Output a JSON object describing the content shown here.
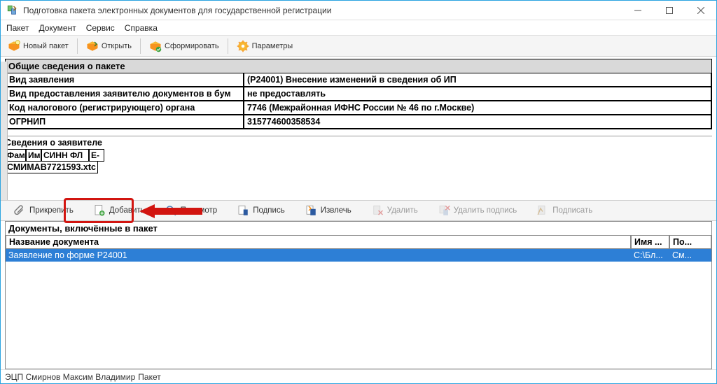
{
  "title": "Подготовка пакета электронных документов для государственной регистрации",
  "menu": {
    "packet": "Пакет",
    "document": "Документ",
    "service": "Сервис",
    "help": "Справка"
  },
  "toolbar1": {
    "new": "Новый пакет",
    "open": "Открыть",
    "form": "Сформировать",
    "params": "Параметры"
  },
  "general": {
    "header": "Общие сведения о пакете",
    "rows": [
      {
        "k": "Вид заявления",
        "v": "(Р24001) Внесение изменений в сведения об ИП"
      },
      {
        "k": "Вид предоставления заявителю документов в бум",
        "v": "не предоставлять"
      },
      {
        "k": "Код налогового (регистрирующего) органа",
        "v": "7746 (Межрайонная ИФНС России № 46 по г.Москве)"
      },
      {
        "k": "ОГРНИП",
        "v": "315774600358534"
      }
    ]
  },
  "applicant": {
    "header": "Сведения о заявителе",
    "hdr": [
      "Фам",
      "Им",
      "СИНН ФЛ",
      "Е-"
    ],
    "row": "СМИМАВ7721593.xtc"
  },
  "toolbar2": {
    "attach": "Прикрепить",
    "add": "Добавить",
    "view": "Просмотр",
    "sign": "Подпись",
    "extract": "Извлечь",
    "delete": "Удалить",
    "delsig": "Удалить подпись",
    "sign2": "Подписать"
  },
  "docs": {
    "header": "Документы, включённые в пакет",
    "cols": [
      "Название документа",
      "Имя ...",
      "По..."
    ],
    "rows": [
      {
        "name": "Заявление по форме Р24001",
        "file": "C:\\Бл...",
        "sign": "См..."
      }
    ]
  },
  "status": {
    "a": "ЭЦП Смирнов Максим Владимир",
    "b": "Пакет"
  }
}
